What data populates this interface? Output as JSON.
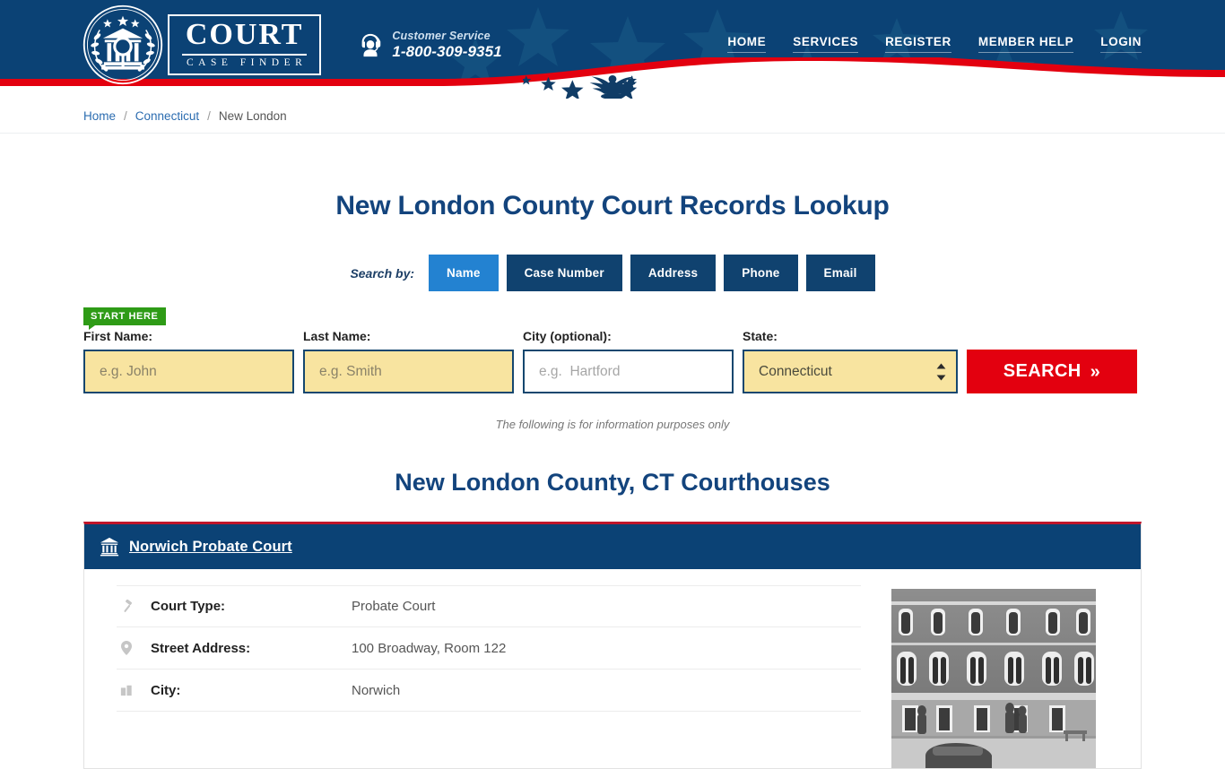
{
  "header": {
    "logo": {
      "word": "COURT",
      "subtitle": "CASE FINDER",
      "seal_icon": "courthouse-seal-icon"
    },
    "customer_service": {
      "icon": "headset-support-icon",
      "label": "Customer Service",
      "phone": "1-800-309-9351"
    },
    "nav": [
      {
        "label": "HOME"
      },
      {
        "label": "SERVICES"
      },
      {
        "label": "REGISTER"
      },
      {
        "label": "MEMBER HELP"
      },
      {
        "label": "LOGIN"
      }
    ],
    "decor": {
      "eagle_icon": "eagle-emblem-icon",
      "banner_color": "#0b4275",
      "wave_color": "#e3000f"
    }
  },
  "breadcrumb": {
    "items": [
      {
        "label": "Home",
        "link": true
      },
      {
        "label": "Connecticut",
        "link": true
      },
      {
        "label": "New London",
        "link": false
      }
    ],
    "separator": "/"
  },
  "main": {
    "page_title": "New London County Court Records Lookup",
    "search_by_label": "Search by:",
    "tabs": [
      {
        "label": "Name",
        "active": true
      },
      {
        "label": "Case Number",
        "active": false
      },
      {
        "label": "Address",
        "active": false
      },
      {
        "label": "Phone",
        "active": false
      },
      {
        "label": "Email",
        "active": false
      }
    ],
    "start_badge": "START HERE",
    "form": {
      "first_name": {
        "label": "First Name:",
        "placeholder": "e.g. John",
        "value": ""
      },
      "last_name": {
        "label": "Last Name:",
        "placeholder": "e.g. Smith",
        "value": ""
      },
      "city": {
        "label": "City (optional):",
        "placeholder": "e.g.  Hartford",
        "value": ""
      },
      "state": {
        "label": "State:",
        "value": "Connecticut"
      },
      "search_button": "SEARCH",
      "search_button_chevron": "»"
    },
    "info_note": "The following is for information purposes only",
    "section_title": "New London County, CT Courthouses"
  },
  "court_card": {
    "header_icon": "bank-courthouse-icon",
    "title": "Norwich Probate Court",
    "photo_alt": "norwich-probate-court-building-photo",
    "details": [
      {
        "icon": "gavel-icon",
        "label": "Court Type:",
        "value": "Probate Court"
      },
      {
        "icon": "map-pin-icon",
        "label": "Street Address:",
        "value": "100 Broadway, Room 122"
      },
      {
        "icon": "city-icon",
        "label": "City:",
        "value": "Norwich"
      }
    ]
  },
  "colors": {
    "navy": "#0b4275",
    "navy_dark": "#10426f",
    "accent_blue": "#2382d1",
    "red": "#e3000f",
    "card_red": "#c0152a",
    "green": "#2e9b16",
    "field_yellow": "#f8e4a0",
    "title_blue": "#13447d"
  }
}
